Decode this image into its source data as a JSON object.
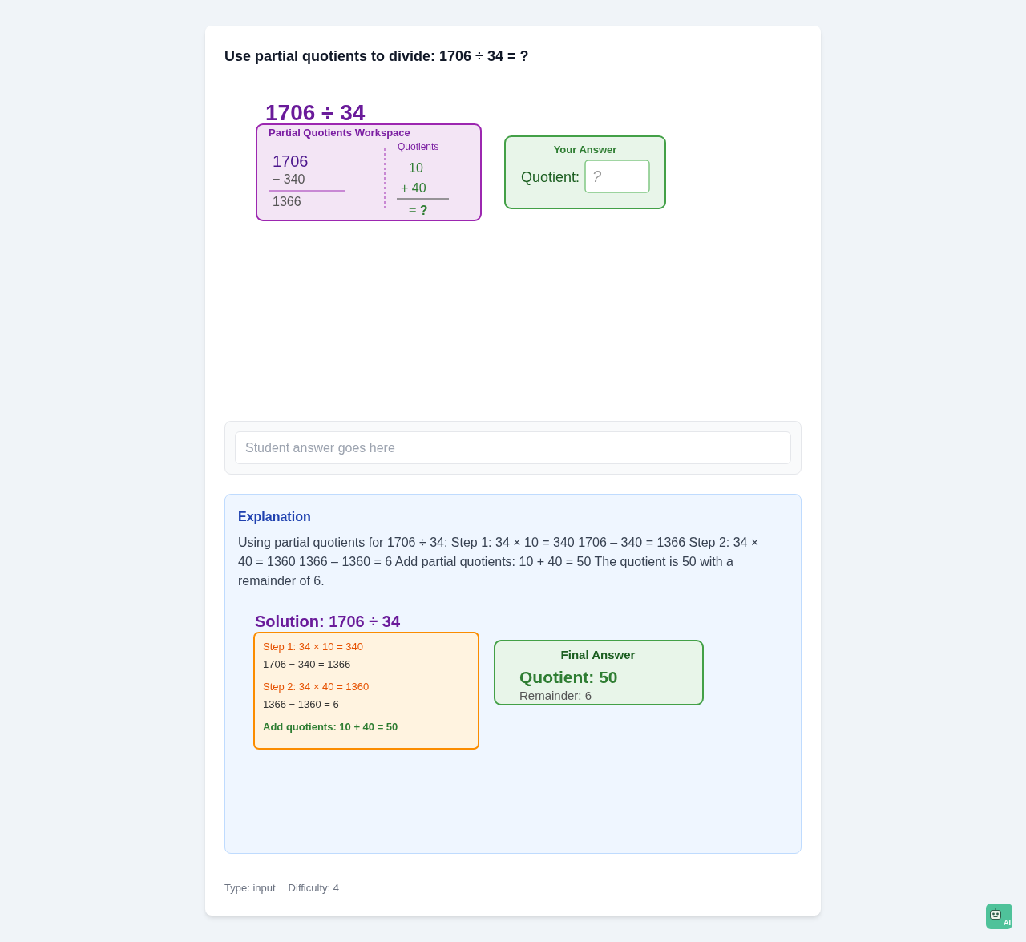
{
  "question": {
    "prompt": "Use partial quotients to divide: 1706 ÷ 34 = ?"
  },
  "workspace_figure": {
    "heading": "1706 ÷ 34",
    "panel_title": "Partial Quotients Workspace",
    "dividend": "1706",
    "subtraction": "− 340",
    "difference": "1366",
    "quotients_label": "Quotients",
    "quotient_terms": [
      "10",
      "+ 40"
    ],
    "quotient_total": "= ?",
    "answer_panel": {
      "title": "Your Answer",
      "label": "Quotient:",
      "placeholder": "?"
    }
  },
  "answer_input": {
    "placeholder": "Student answer goes here"
  },
  "explanation": {
    "title": "Explanation",
    "text": "Using partial quotients for 1706 ÷ 34: Step 1: 34 × 10 = 340 1706 – 340 = 1366 Step 2: 34 × 40 = 1360 1366 – 1360 = 6 Add partial quotients: 10 + 40 = 50 The quotient is 50 with a remainder of 6.",
    "solution_figure": {
      "heading": "Solution: 1706 ÷ 34",
      "steps": [
        {
          "kind": "step",
          "text": "Step 1: 34 × 10 = 340"
        },
        {
          "kind": "work",
          "text": "1706 − 340 = 1366"
        },
        {
          "kind": "step",
          "text": "Step 2: 34 × 40 = 1360"
        },
        {
          "kind": "work",
          "text": "1366 − 1360 = 6"
        },
        {
          "kind": "total",
          "text": "Add quotients: 10 + 40 = 50"
        }
      ],
      "final_answer": {
        "title": "Final Answer",
        "quotient": "Quotient: 50",
        "remainder": "Remainder: 6"
      }
    }
  },
  "meta": {
    "type": "Type: input",
    "difficulty": "Difficulty: 4"
  },
  "assistant_badge": {
    "label": "AI"
  }
}
